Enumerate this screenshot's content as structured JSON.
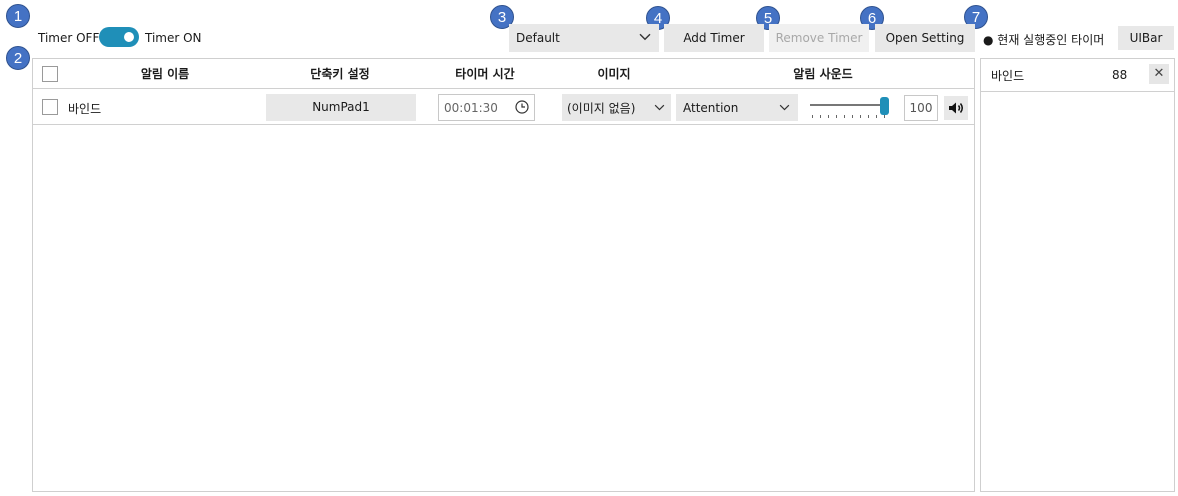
{
  "badges": [
    "1",
    "2",
    "3",
    "4",
    "5",
    "6",
    "7"
  ],
  "toggle": {
    "off_label": "Timer OFF",
    "on_label": "Timer ON",
    "state": "on"
  },
  "profile_select": {
    "value": "Default"
  },
  "toolbar": {
    "add_label": "Add Timer",
    "remove_label": "Remove Timer",
    "open_setting_label": "Open Setting",
    "running_label": "● 현재 실행중인 타이머",
    "uibar_label": "UIBar"
  },
  "table": {
    "headers": {
      "name": "알림 이름",
      "hotkey": "단축키 설정",
      "time": "타이머 시간",
      "image": "이미지",
      "sound": "알림 사운드"
    },
    "rows": [
      {
        "name": "바인드",
        "hotkey": "NumPad1",
        "time": "00:01:30",
        "image": "(이미지 없음)",
        "sound": "Attention",
        "volume": "100"
      }
    ]
  },
  "running": [
    {
      "name": "바인드",
      "remaining": "88"
    }
  ],
  "icons": {
    "dropdown": "chevron-down-icon",
    "clock": "clock-icon",
    "speaker": "speaker-icon",
    "close": "close-icon"
  },
  "colors": {
    "accent": "#1f8fb8",
    "badge": "#4472c4"
  }
}
